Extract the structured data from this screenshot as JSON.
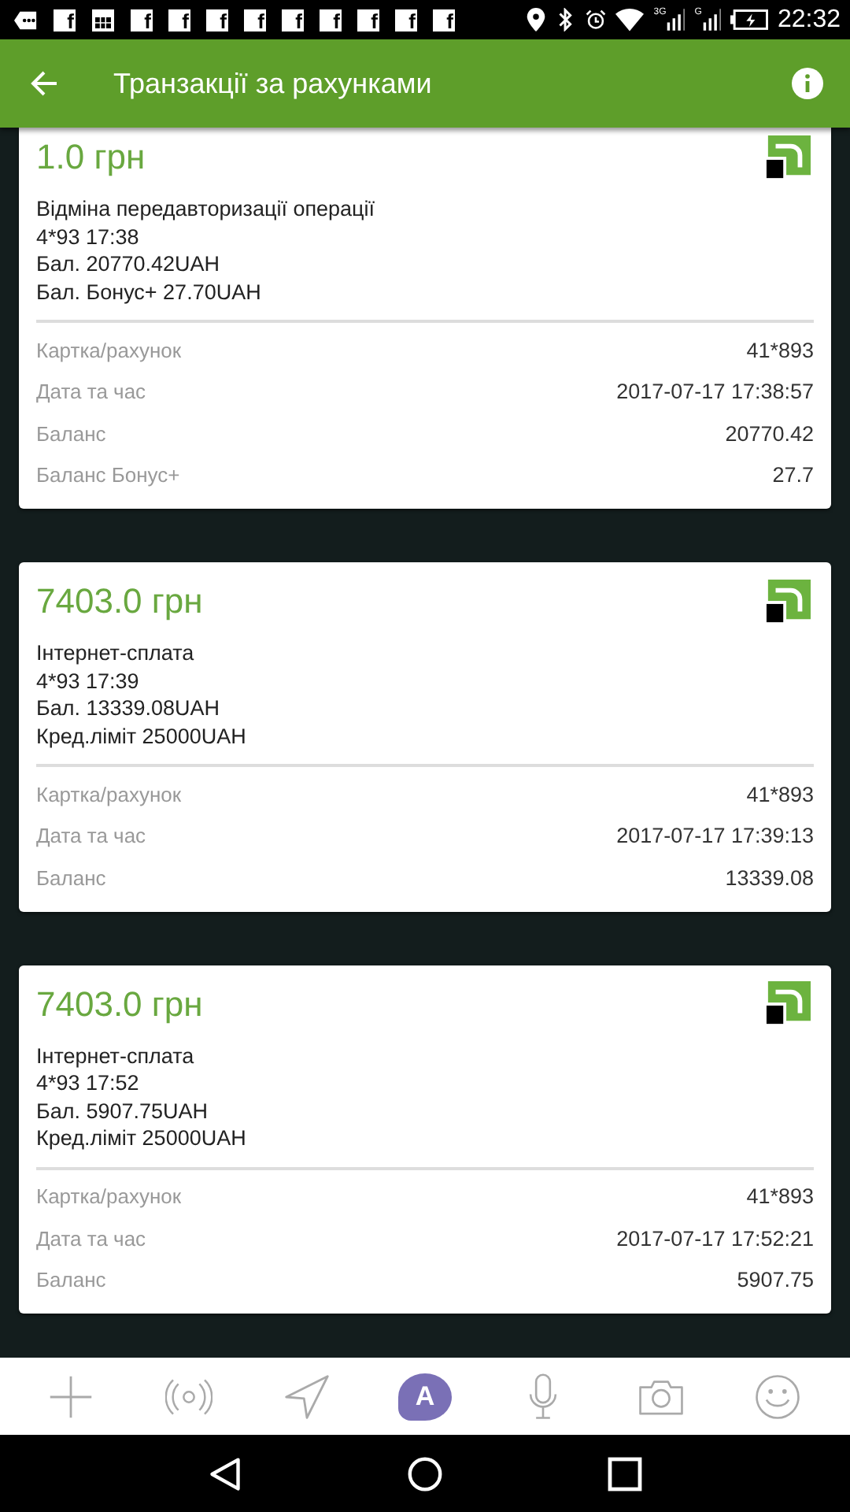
{
  "status_bar": {
    "notifications": [
      {
        "kind": "chat"
      },
      {
        "kind": "facebook",
        "label": "f"
      },
      {
        "kind": "calendar"
      },
      {
        "kind": "facebook",
        "label": "f"
      },
      {
        "kind": "facebook",
        "label": "f"
      },
      {
        "kind": "facebook",
        "label": "f"
      },
      {
        "kind": "facebook",
        "label": "f"
      },
      {
        "kind": "facebook",
        "label": "f"
      },
      {
        "kind": "facebook",
        "label": "f"
      },
      {
        "kind": "facebook",
        "label": "f"
      },
      {
        "kind": "facebook",
        "label": "f"
      },
      {
        "kind": "facebook",
        "label": "f"
      }
    ],
    "networks": [
      "3G",
      "G"
    ],
    "time": "22:32"
  },
  "app_bar": {
    "title": "Транзакції за рахунками"
  },
  "transactions": [
    {
      "amount": "1.0 грн",
      "details": [
        "Відміна передавторизації операції",
        "4*93 17:38",
        "Бал. 20770.42UAH",
        "Бал. Бонус+ 27.70UAH"
      ],
      "fields": [
        {
          "label": "Картка/рахунок",
          "value": "41*893"
        },
        {
          "label": "Дата та час",
          "value": "2017-07-17 17:38:57"
        },
        {
          "label": "Баланс",
          "value": "20770.42"
        },
        {
          "label": "Баланс Бонус+",
          "value": "27.7"
        }
      ]
    },
    {
      "amount": "7403.0 грн",
      "details": [
        "Інтернет-сплата",
        "4*93 17:39",
        "Бал. 13339.08UAH",
        "Кред.ліміт 25000UAH"
      ],
      "fields": [
        {
          "label": "Картка/рахунок",
          "value": "41*893"
        },
        {
          "label": "Дата та час",
          "value": "2017-07-17 17:39:13"
        },
        {
          "label": "Баланс",
          "value": "13339.08"
        }
      ]
    },
    {
      "amount": "7403.0 грн",
      "details": [
        "Інтернет-сплата",
        "4*93 17:52",
        "Бал. 5907.75UAH",
        "Кред.ліміт 25000UAH"
      ],
      "fields": [
        {
          "label": "Картка/рахунок",
          "value": "41*893"
        },
        {
          "label": "Дата та час",
          "value": "2017-07-17 17:52:21"
        },
        {
          "label": "Баланс",
          "value": "5907.75"
        }
      ]
    }
  ],
  "toolbar": [
    {
      "kind": "plus",
      "selected": false
    },
    {
      "kind": "broadcast",
      "selected": false
    },
    {
      "kind": "location",
      "selected": false
    },
    {
      "kind": "sticker",
      "label": "A",
      "selected": true
    },
    {
      "kind": "microphone",
      "selected": false
    },
    {
      "kind": "camera",
      "selected": false
    },
    {
      "kind": "emoji",
      "selected": false
    }
  ]
}
